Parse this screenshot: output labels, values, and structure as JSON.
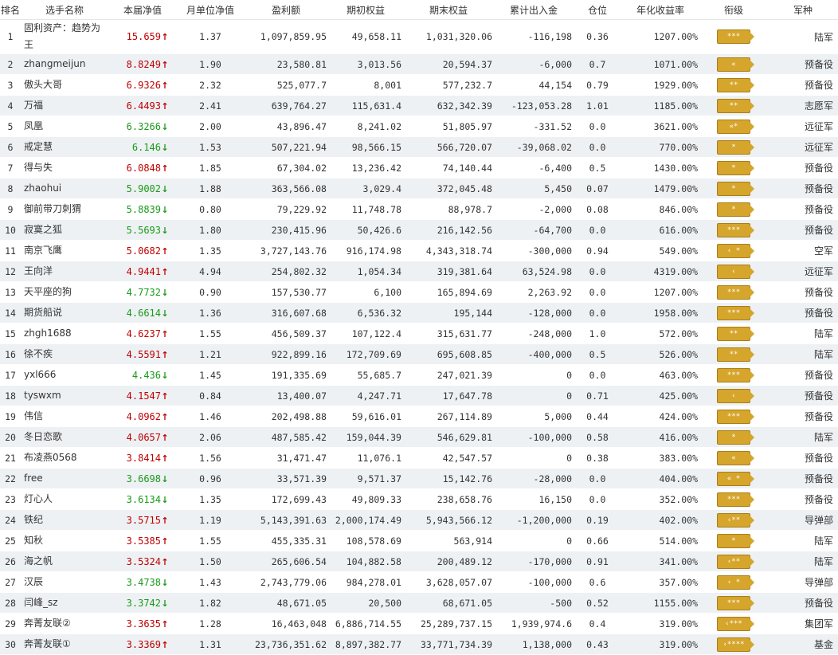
{
  "headers": [
    "排名",
    "选手名称",
    "本届净值",
    "月单位净值",
    "盈利额",
    "期初权益",
    "期末权益",
    "累计出入金",
    "仓位",
    "年化收益率",
    "衔级",
    "军种"
  ],
  "colors": {
    "up": "#c00000",
    "down": "#1a9a1a",
    "alt_row": "#eef1f4",
    "rank_badge": "#d6a52c"
  },
  "rows": [
    {
      "rank": "1",
      "name": "固利资产：趋势为王",
      "nav": "15.659",
      "dir": "up",
      "monthly": "1.37",
      "profit": "1,097,859.95",
      "begin": "49,658.11",
      "end": "1,031,320.06",
      "flow": "-116,198",
      "pos": "0.36",
      "annual": "1207.00%",
      "badge": "***",
      "branch": "陆军"
    },
    {
      "rank": "2",
      "name": "zhangmeijun",
      "nav": "8.8249",
      "dir": "up",
      "monthly": "1.90",
      "profit": "23,580.81",
      "begin": "3,013.56",
      "end": "20,594.37",
      "flow": "-6,000",
      "pos": "0.7",
      "annual": "1071.00%",
      "badge": "«",
      "branch": "预备役"
    },
    {
      "rank": "3",
      "name": "傲头大哥",
      "nav": "6.9326",
      "dir": "up",
      "monthly": "2.32",
      "profit": "525,077.7",
      "begin": "8,001",
      "end": "577,232.7",
      "flow": "44,154",
      "pos": "0.79",
      "annual": "1929.00%",
      "badge": "**",
      "branch": "预备役"
    },
    {
      "rank": "4",
      "name": "万福",
      "nav": "6.4493",
      "dir": "up",
      "monthly": "2.41",
      "profit": "639,764.27",
      "begin": "115,631.4",
      "end": "632,342.39",
      "flow": "-123,053.28",
      "pos": "1.01",
      "annual": "1185.00%",
      "badge": "**",
      "branch": "志愿军"
    },
    {
      "rank": "5",
      "name": "凤凰",
      "nav": "6.3266",
      "dir": "down",
      "monthly": "2.00",
      "profit": "43,896.47",
      "begin": "8,241.02",
      "end": "51,805.97",
      "flow": "-331.52",
      "pos": "0.0",
      "annual": "3621.00%",
      "badge": "«*",
      "branch": "远征军"
    },
    {
      "rank": "6",
      "name": "戒定慧",
      "nav": "6.146",
      "dir": "down",
      "monthly": "1.53",
      "profit": "507,221.94",
      "begin": "98,566.15",
      "end": "566,720.07",
      "flow": "-39,068.02",
      "pos": "0.0",
      "annual": "770.00%",
      "badge": "*",
      "branch": "远征军"
    },
    {
      "rank": "7",
      "name": "得与失",
      "nav": "6.0848",
      "dir": "up",
      "monthly": "1.85",
      "profit": "67,304.02",
      "begin": "13,236.42",
      "end": "74,140.44",
      "flow": "-6,400",
      "pos": "0.5",
      "annual": "1430.00%",
      "badge": "*",
      "branch": "预备役"
    },
    {
      "rank": "8",
      "name": "zhaohui",
      "nav": "5.9002",
      "dir": "down",
      "monthly": "1.88",
      "profit": "363,566.08",
      "begin": "3,029.4",
      "end": "372,045.48",
      "flow": "5,450",
      "pos": "0.07",
      "annual": "1479.00%",
      "badge": "*",
      "branch": "预备役"
    },
    {
      "rank": "9",
      "name": "御前带刀刺猬",
      "nav": "5.8839",
      "dir": "down",
      "monthly": "0.80",
      "profit": "79,229.92",
      "begin": "11,748.78",
      "end": "88,978.7",
      "flow": "-2,000",
      "pos": "0.08",
      "annual": "846.00%",
      "badge": "*",
      "branch": "预备役"
    },
    {
      "rank": "10",
      "name": "寂寞之狐",
      "nav": "5.5693",
      "dir": "down",
      "monthly": "1.80",
      "profit": "230,415.96",
      "begin": "50,426.6",
      "end": "216,142.56",
      "flow": "-64,700",
      "pos": "0.0",
      "annual": "616.00%",
      "badge": "***",
      "branch": "预备役"
    },
    {
      "rank": "11",
      "name": "南京飞鹰",
      "nav": "5.0682",
      "dir": "up",
      "monthly": "1.35",
      "profit": "3,727,143.76",
      "begin": "916,174.98",
      "end": "4,343,318.74",
      "flow": "-300,000",
      "pos": "0.94",
      "annual": "549.00%",
      "badge": "‹ *",
      "branch": "空军"
    },
    {
      "rank": "12",
      "name": "王向洋",
      "nav": "4.9441",
      "dir": "up",
      "monthly": "4.94",
      "profit": "254,802.32",
      "begin": "1,054.34",
      "end": "319,381.64",
      "flow": "63,524.98",
      "pos": "0.0",
      "annual": "4319.00%",
      "badge": "‹",
      "branch": "远征军"
    },
    {
      "rank": "13",
      "name": "天平座的狗",
      "nav": "4.7732",
      "dir": "down",
      "monthly": "0.90",
      "profit": "157,530.77",
      "begin": "6,100",
      "end": "165,894.69",
      "flow": "2,263.92",
      "pos": "0.0",
      "annual": "1207.00%",
      "badge": "***",
      "branch": "预备役"
    },
    {
      "rank": "14",
      "name": "期货船说",
      "nav": "4.6614",
      "dir": "down",
      "monthly": "1.36",
      "profit": "316,607.68",
      "begin": "6,536.32",
      "end": "195,144",
      "flow": "-128,000",
      "pos": "0.0",
      "annual": "1958.00%",
      "badge": "***",
      "branch": "预备役"
    },
    {
      "rank": "15",
      "name": "zhgh1688",
      "nav": "4.6237",
      "dir": "up",
      "monthly": "1.55",
      "profit": "456,509.37",
      "begin": "107,122.4",
      "end": "315,631.77",
      "flow": "-248,000",
      "pos": "1.0",
      "annual": "572.00%",
      "badge": "**",
      "branch": "陆军"
    },
    {
      "rank": "16",
      "name": "徐不疾",
      "nav": "4.5591",
      "dir": "up",
      "monthly": "1.21",
      "profit": "922,899.16",
      "begin": "172,709.69",
      "end": "695,608.85",
      "flow": "-400,000",
      "pos": "0.5",
      "annual": "526.00%",
      "badge": "**",
      "branch": "陆军"
    },
    {
      "rank": "17",
      "name": "yxl666",
      "nav": "4.436",
      "dir": "down",
      "monthly": "1.45",
      "profit": "191,335.69",
      "begin": "55,685.7",
      "end": "247,021.39",
      "flow": "0",
      "pos": "0.0",
      "annual": "463.00%",
      "badge": "***",
      "branch": "预备役"
    },
    {
      "rank": "18",
      "name": "tyswxm",
      "nav": "4.1547",
      "dir": "up",
      "monthly": "0.84",
      "profit": "13,400.07",
      "begin": "4,247.71",
      "end": "17,647.78",
      "flow": "0",
      "pos": "0.71",
      "annual": "425.00%",
      "badge": "‹",
      "branch": "预备役"
    },
    {
      "rank": "19",
      "name": "伟信",
      "nav": "4.0962",
      "dir": "up",
      "monthly": "1.46",
      "profit": "202,498.88",
      "begin": "59,616.01",
      "end": "267,114.89",
      "flow": "5,000",
      "pos": "0.44",
      "annual": "424.00%",
      "badge": "***",
      "branch": "预备役"
    },
    {
      "rank": "20",
      "name": "冬日恋歌",
      "nav": "4.0657",
      "dir": "up",
      "monthly": "2.06",
      "profit": "487,585.42",
      "begin": "159,044.39",
      "end": "546,629.81",
      "flow": "-100,000",
      "pos": "0.58",
      "annual": "416.00%",
      "badge": "*",
      "branch": "陆军"
    },
    {
      "rank": "21",
      "name": "布凌燕0568",
      "nav": "3.8414",
      "dir": "up",
      "monthly": "1.56",
      "profit": "31,471.47",
      "begin": "11,076.1",
      "end": "42,547.57",
      "flow": "0",
      "pos": "0.38",
      "annual": "383.00%",
      "badge": "«",
      "branch": "预备役"
    },
    {
      "rank": "22",
      "name": "free",
      "nav": "3.6698",
      "dir": "down",
      "monthly": "0.96",
      "profit": "33,571.39",
      "begin": "9,571.37",
      "end": "15,142.76",
      "flow": "-28,000",
      "pos": "0.0",
      "annual": "404.00%",
      "badge": "« *",
      "branch": "预备役"
    },
    {
      "rank": "23",
      "name": "灯心人",
      "nav": "3.6134",
      "dir": "down",
      "monthly": "1.35",
      "profit": "172,699.43",
      "begin": "49,809.33",
      "end": "238,658.76",
      "flow": "16,150",
      "pos": "0.0",
      "annual": "352.00%",
      "badge": "***",
      "branch": "预备役"
    },
    {
      "rank": "24",
      "name": "铁纪",
      "nav": "3.5715",
      "dir": "up",
      "monthly": "1.19",
      "profit": "5,143,391.63",
      "begin": "2,000,174.49",
      "end": "5,943,566.12",
      "flow": "-1,200,000",
      "pos": "0.19",
      "annual": "402.00%",
      "badge": "‹**",
      "branch": "导弹部"
    },
    {
      "rank": "25",
      "name": "知秋",
      "nav": "3.5385",
      "dir": "up",
      "monthly": "1.55",
      "profit": "455,335.31",
      "begin": "108,578.69",
      "end": "563,914",
      "flow": "0",
      "pos": "0.66",
      "annual": "514.00%",
      "badge": "*",
      "branch": "陆军"
    },
    {
      "rank": "26",
      "name": "海之帆",
      "nav": "3.5324",
      "dir": "up",
      "monthly": "1.50",
      "profit": "265,606.54",
      "begin": "104,882.58",
      "end": "200,489.12",
      "flow": "-170,000",
      "pos": "0.91",
      "annual": "341.00%",
      "badge": "‹**",
      "branch": "陆军"
    },
    {
      "rank": "27",
      "name": "汉辰",
      "nav": "3.4738",
      "dir": "down",
      "monthly": "1.43",
      "profit": "2,743,779.06",
      "begin": "984,278.01",
      "end": "3,628,057.07",
      "flow": "-100,000",
      "pos": "0.6",
      "annual": "357.00%",
      "badge": "‹ *",
      "branch": "导弹部"
    },
    {
      "rank": "28",
      "name": "闫峰_sz",
      "nav": "3.3742",
      "dir": "down",
      "monthly": "1.82",
      "profit": "48,671.05",
      "begin": "20,500",
      "end": "68,671.05",
      "flow": "-500",
      "pos": "0.52",
      "annual": "1155.00%",
      "badge": "***",
      "branch": "预备役"
    },
    {
      "rank": "29",
      "name": "奔菁友联②",
      "nav": "3.3635",
      "dir": "up",
      "monthly": "1.28",
      "profit": "16,463,048",
      "begin": "6,886,714.55",
      "end": "25,289,737.15",
      "flow": "1,939,974.6",
      "pos": "0.4",
      "annual": "319.00%",
      "badge": "‹***",
      "branch": "集团军"
    },
    {
      "rank": "30",
      "name": "奔菁友联①",
      "nav": "3.3369",
      "dir": "up",
      "monthly": "1.31",
      "profit": "23,736,351.62",
      "begin": "8,897,382.77",
      "end": "33,771,734.39",
      "flow": "1,138,000",
      "pos": "0.43",
      "annual": "319.00%",
      "badge": "‹****",
      "branch": "基金"
    }
  ]
}
